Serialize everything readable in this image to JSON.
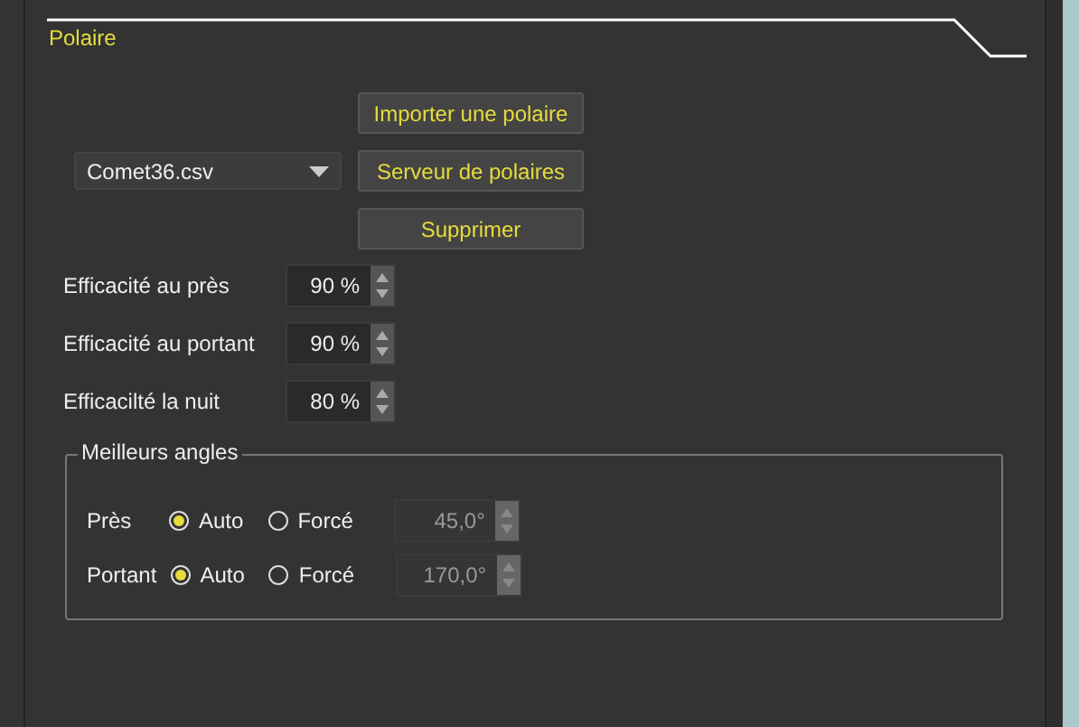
{
  "section": {
    "title": "Polaire"
  },
  "polar_file": {
    "value": "Comet36.csv"
  },
  "buttons": [
    {
      "label": "Importer une polaire"
    },
    {
      "label": "Serveur de polaires"
    },
    {
      "label": "Supprimer"
    }
  ],
  "efficiencies": [
    {
      "label": "Efficacité au près",
      "value": "90 %"
    },
    {
      "label": "Efficacité au portant",
      "value": "90 %"
    },
    {
      "label": "Efficacilté la nuit",
      "value": "80 %"
    }
  ],
  "best_angles": {
    "title": "Meilleurs angles",
    "rows": [
      {
        "label": "Près",
        "options": [
          {
            "label": "Auto",
            "selected": true
          },
          {
            "label": "Forcé",
            "selected": false
          }
        ],
        "angle": {
          "value": "45,0°",
          "disabled": true
        }
      },
      {
        "label": "Portant",
        "options": [
          {
            "label": "Auto",
            "selected": true
          },
          {
            "label": "Forcé",
            "selected": false
          }
        ],
        "angle": {
          "value": "170,0°",
          "disabled": true
        }
      }
    ]
  }
}
